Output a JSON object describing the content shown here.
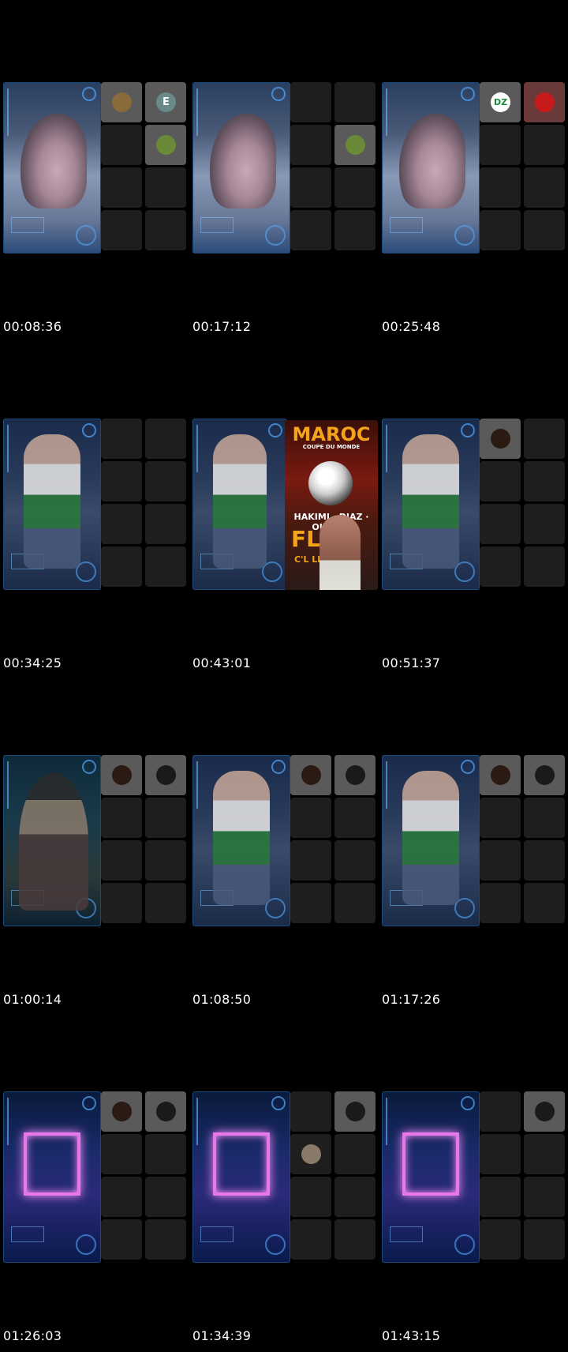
{
  "cells": [
    {
      "time": "00:08:36",
      "scene": "man",
      "tiles": [
        {
          "idx": 0,
          "kind": "avatar",
          "avatar": "bear-avatar",
          "bg": "#8a6a3a"
        },
        {
          "idx": 1,
          "kind": "letter",
          "letter": "E",
          "bg": "#6a8a8a"
        },
        {
          "idx": 3,
          "kind": "avatar",
          "avatar": "green-avatar",
          "bg": "#6a8a3a"
        }
      ]
    },
    {
      "time": "00:17:12",
      "scene": "man",
      "tiles": [
        {
          "idx": 3,
          "kind": "avatar",
          "avatar": "green-avatar",
          "bg": "#6a8a3a"
        }
      ]
    },
    {
      "time": "00:25:48",
      "scene": "man",
      "tiles": [
        {
          "idx": 0,
          "kind": "letter",
          "letter": "DZ",
          "bg": "#ffffff",
          "color": "#1a8a3a"
        },
        {
          "idx": 1,
          "kind": "avatar",
          "avatar": "red-symbol-avatar",
          "bg": "#c81a1a",
          "red": true
        }
      ]
    },
    {
      "time": "00:34:25",
      "scene": "baby",
      "tiles": []
    },
    {
      "time": "00:43:01",
      "scene": "baby",
      "tiles": [],
      "promo": true
    },
    {
      "time": "00:51:37",
      "scene": "baby",
      "tiles": [
        {
          "idx": 0,
          "kind": "avatar",
          "avatar": "dark-avatar",
          "bg": "#2a1a12"
        }
      ]
    },
    {
      "time": "01:00:14",
      "scene": "pirate",
      "tiles": [
        {
          "idx": 0,
          "kind": "avatar",
          "avatar": "dark-avatar",
          "bg": "#2a1a12"
        },
        {
          "idx": 1,
          "kind": "avatar",
          "avatar": "mask-avatar",
          "bg": "#1a1a1a"
        }
      ]
    },
    {
      "time": "01:08:50",
      "scene": "baby",
      "tiles": [
        {
          "idx": 0,
          "kind": "avatar",
          "avatar": "dark-avatar",
          "bg": "#2a1a12"
        },
        {
          "idx": 1,
          "kind": "avatar",
          "avatar": "mask-avatar",
          "bg": "#1a1a1a"
        }
      ]
    },
    {
      "time": "01:17:26",
      "scene": "baby",
      "tiles": [
        {
          "idx": 0,
          "kind": "avatar",
          "avatar": "dark-avatar",
          "bg": "#2a1a12"
        },
        {
          "idx": 1,
          "kind": "avatar",
          "avatar": "mask-avatar",
          "bg": "#1a1a1a"
        }
      ]
    },
    {
      "time": "01:26:03",
      "scene": "neon",
      "tiles": [
        {
          "idx": 0,
          "kind": "avatar",
          "avatar": "dark-avatar",
          "bg": "#2a1a12"
        },
        {
          "idx": 1,
          "kind": "avatar",
          "avatar": "mask-avatar",
          "bg": "#1a1a1a"
        }
      ]
    },
    {
      "time": "01:34:39",
      "scene": "neon",
      "tiles": [
        {
          "idx": 1,
          "kind": "avatar",
          "avatar": "mask-avatar",
          "bg": "#1a1a1a"
        },
        {
          "idx": 2,
          "kind": "avatar",
          "avatar": "man-avatar",
          "bg": "#8a7a6a",
          "dark": true
        }
      ]
    },
    {
      "time": "01:43:15",
      "scene": "neon",
      "tiles": [
        {
          "idx": 1,
          "kind": "avatar",
          "avatar": "mask-avatar",
          "bg": "#1a1a1a"
        }
      ]
    }
  ],
  "promo": {
    "title": "MAROC",
    "subtitle": "COUPE DU MONDE",
    "names": "HAKIMI · DIAZ · OUNAHI",
    "big": "FL",
    "small": "C'L LE P"
  }
}
